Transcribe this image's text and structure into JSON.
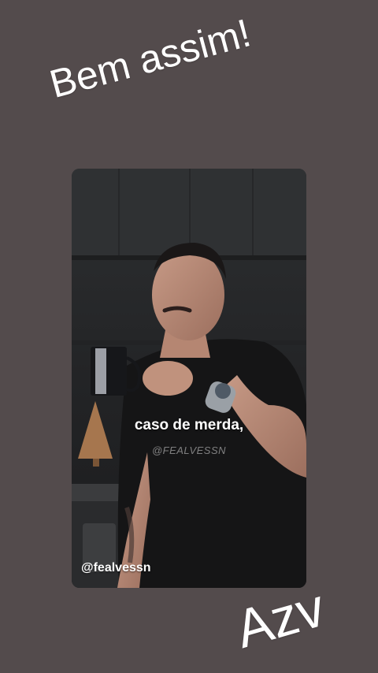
{
  "story": {
    "top_text": "Bem assim!",
    "bottom_text": "Azv",
    "background_color": "#534b4c"
  },
  "video": {
    "caption": "caso de merda,",
    "watermark": "@FEALVESSN",
    "handle": "@fealvessn"
  }
}
